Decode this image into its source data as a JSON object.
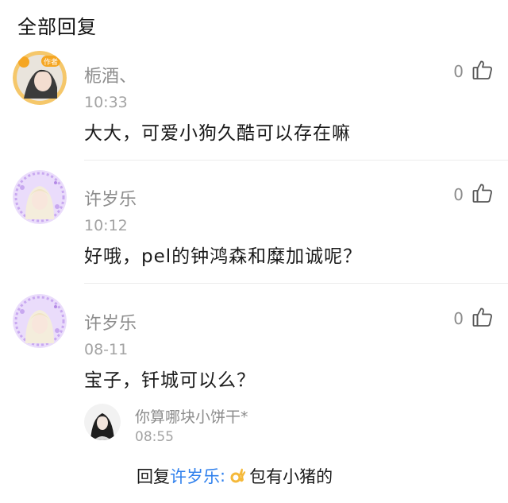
{
  "header": {
    "title": "全部回复"
  },
  "comments": [
    {
      "username": "栀酒、",
      "time": "10:33",
      "text": "大大，可爱小狗久酷可以存在嘛",
      "likes": "0",
      "avatar_badge": "作者"
    },
    {
      "username": "许岁乐",
      "time": "10:12",
      "text": "好哦，pel的钟鸿森和糜加诚呢？",
      "likes": "0"
    },
    {
      "username": "许岁乐",
      "time": "08-11",
      "text": "宝子，钎城可以么？",
      "likes": "0"
    }
  ],
  "reply": {
    "username": "你算哪块小饼干*",
    "time": "08:55",
    "prefix": "回复",
    "target": "许岁乐",
    "colon": ":",
    "emoji_icon": "ok-hand-emoji-icon",
    "text": "包有小猪的"
  },
  "colors": {
    "link": "#2f80ed",
    "meta": "#8c8c8c",
    "avatar_purple": "#c8a8f0",
    "badge_orange": "#f5a623"
  }
}
